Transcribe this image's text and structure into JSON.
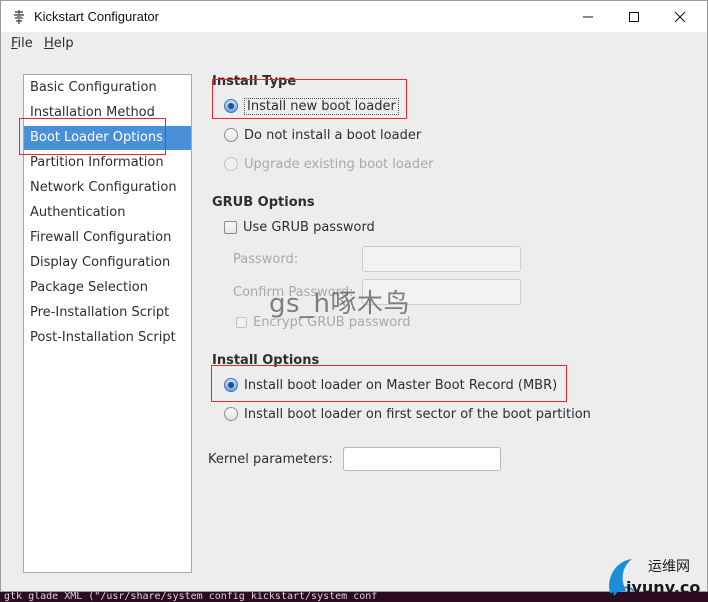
{
  "window": {
    "title": "Kickstart Configurator"
  },
  "menu": {
    "file": "File",
    "file_u": "F",
    "file_rest": "ile",
    "help_u": "H",
    "help_rest": "elp"
  },
  "sidebar": {
    "items": [
      "Basic Configuration",
      "Installation Method",
      "Boot Loader Options",
      "Partition Information",
      "Network Configuration",
      "Authentication",
      "Firewall Configuration",
      "Display Configuration",
      "Package Selection",
      "Pre-Installation Script",
      "Post-Installation Script"
    ],
    "selected": "Boot Loader Options"
  },
  "install_type": {
    "title": "Install Type",
    "options": [
      "Install new boot loader",
      "Do not install a boot loader",
      "Upgrade existing boot loader"
    ],
    "selected": "Install new boot loader"
  },
  "grub": {
    "title": "GRUB Options",
    "use_password": "Use GRUB password",
    "password_label": "Password:",
    "confirm_label": "Confirm Password:",
    "encrypt": "Encrypt GRUB password"
  },
  "install_options": {
    "title": "Install Options",
    "options": [
      "Install boot loader on Master Boot Record (MBR)",
      "Install boot loader on first sector of the boot partition"
    ],
    "selected": "Install boot loader on Master Boot Record (MBR)"
  },
  "kernel": {
    "label": "Kernel parameters:",
    "value": ""
  },
  "watermark": "gs_h啄木鸟",
  "terminal_text": "gtk glade XML (\"/usr/share/system config kickstart/system conf",
  "logo": {
    "text": "运维网",
    "domain": "iyunv.com"
  },
  "colors": {
    "selection": "#4a90d9",
    "highlight_box": "#e8262f"
  }
}
